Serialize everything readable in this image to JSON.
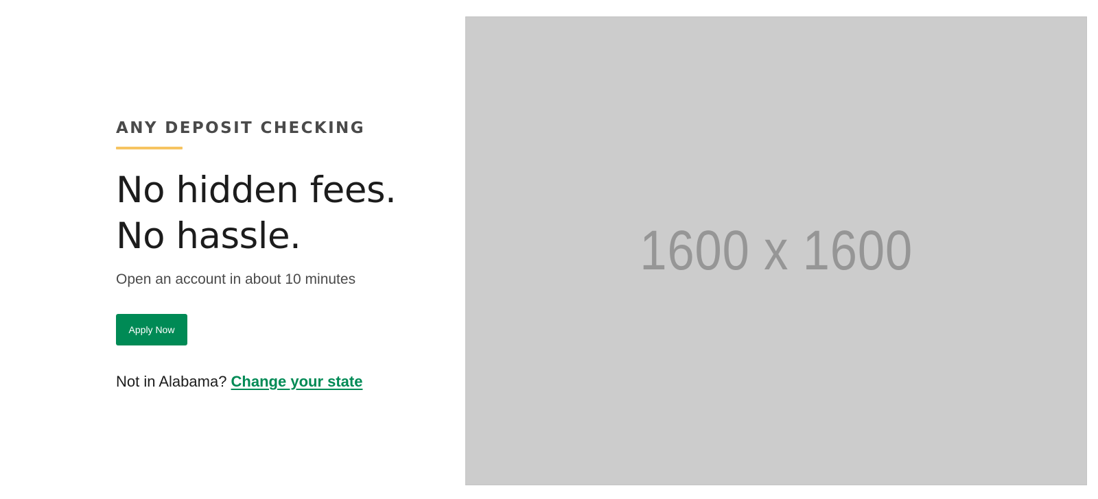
{
  "hero": {
    "eyebrow": "ANY DEPOSIT CHECKING",
    "headline_line1": "No hidden fees.",
    "headline_line2": "No hassle.",
    "subtext": "Open an account in about 10 minutes",
    "apply_label": "Apply Now",
    "state_prompt": "Not in Alabama?",
    "state_link_label": "Change your state"
  },
  "image": {
    "placeholder_label": "1600 x 1600"
  },
  "colors": {
    "accent_rule": "#f6c461",
    "primary_green": "#008a55",
    "placeholder_bg": "#cccccc",
    "placeholder_text": "#969696"
  }
}
